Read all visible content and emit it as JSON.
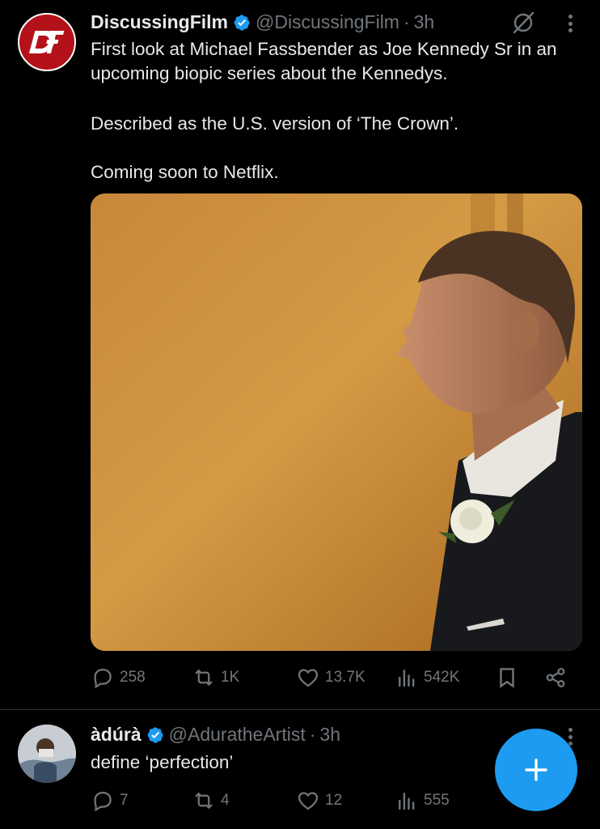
{
  "tweets": [
    {
      "author": "DiscussingFilm",
      "handle": "@DiscussingFilm",
      "dot": "·",
      "time": "3h",
      "paragraphs": [
        "First look at Michael Fassbender as Joe Kennedy Sr in an upcoming biopic series about the Kennedys.",
        "Described as the U.S. version of ‘The Crown’.",
        "Coming soon to Netflix."
      ],
      "avatar_icon": "discussingfilm-logo",
      "stats": {
        "replies": "258",
        "reposts": "1K",
        "likes": "13.7K",
        "views": "542K"
      }
    },
    {
      "author": "àdúrà",
      "handle": "@AduratheArtist",
      "dot": "·",
      "time": "3h",
      "paragraphs": [
        "define ‘perfection’"
      ],
      "stats": {
        "replies": "7",
        "reposts": "4",
        "likes": "12",
        "views": "555"
      }
    }
  ],
  "icons": {
    "verified": "verified-badge-icon",
    "grok": "grok-icon",
    "more": "more-options-icon",
    "reply": "reply-icon",
    "repost": "repost-icon",
    "like": "like-icon",
    "views": "views-icon",
    "bookmark": "bookmark-icon",
    "share": "share-icon",
    "compose": "compose-plus-icon"
  },
  "colors": {
    "background": "#000000",
    "text": "#e7e9ea",
    "muted": "#71767b",
    "accent": "#1d9bf0",
    "divider": "#2f3336"
  }
}
